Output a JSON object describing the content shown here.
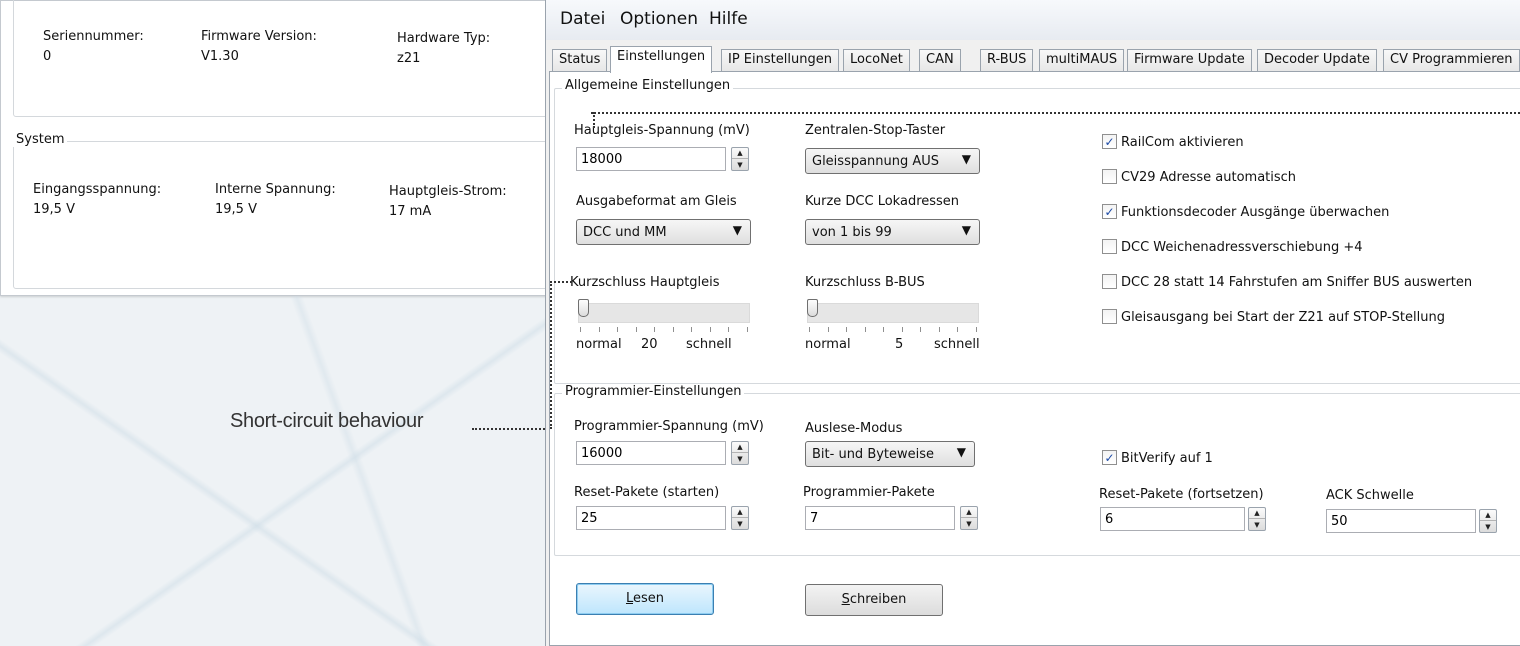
{
  "status_window": {
    "device": {
      "serial_label": "Seriennummer:",
      "serial_value": "0",
      "firmware_label": "Firmware Version:",
      "firmware_value": "V1.30",
      "hardware_label": "Hardware Typ:",
      "hardware_value": "z21"
    },
    "system": {
      "title": "System",
      "input_voltage_label": "Eingangsspannung:",
      "input_voltage_value": "19,5 V",
      "internal_voltage_label": "Interne Spannung:",
      "internal_voltage_value": "19,5 V",
      "track_current_label": "Hauptgleis-Strom:",
      "track_current_value": "17 mA"
    }
  },
  "annotation": {
    "caption": "Short-circuit behaviour"
  },
  "settings_window": {
    "menu": [
      "Datei",
      "Optionen",
      "Hilfe"
    ],
    "tabs": [
      "Status",
      "Einstellungen",
      "IP Einstellungen",
      "LocoNet",
      "CAN",
      "R-BUS",
      "multiMAUS",
      "Firmware Update",
      "Decoder Update",
      "CV Programmieren"
    ],
    "active_tab": "Einstellungen",
    "general": {
      "title": "Allgemeine Einstellungen",
      "main_voltage_label": "Hauptgleis-Spannung (mV)",
      "main_voltage_value": "18000",
      "stop_button_label": "Zentralen-Stop-Taster",
      "stop_button_value": "Gleisspannung AUS",
      "output_format_label": "Ausgabeformat am Gleis",
      "output_format_value": "DCC und MM",
      "short_dcc_label": "Kurze DCC Lokadressen",
      "short_dcc_value": "von 1 bis 99",
      "short_main_label": "Kurzschluss Hauptgleis",
      "short_main_min": "normal",
      "short_main_value": "20",
      "short_main_max": "schnell",
      "short_bbus_label": "Kurzschluss B-BUS",
      "short_bbus_min": "normal",
      "short_bbus_value": "5",
      "short_bbus_max": "schnell",
      "short_main_level": 0.0,
      "short_bbus_level": 0.0,
      "checkboxes": [
        {
          "label": "RailCom aktivieren",
          "checked": true
        },
        {
          "label": "CV29 Adresse automatisch",
          "checked": false
        },
        {
          "label": "Funktionsdecoder Ausgänge überwachen",
          "checked": true
        },
        {
          "label": "DCC Weichenadressverschiebung +4",
          "checked": false
        },
        {
          "label": "DCC 28 statt 14 Fahrstufen am Sniffer BUS auswerten",
          "checked": false
        },
        {
          "label": "Gleisausgang bei Start der Z21 auf STOP-Stellung",
          "checked": false
        }
      ]
    },
    "programmer": {
      "title": "Programmier-Einstellungen",
      "prog_voltage_label": "Programmier-Spannung (mV)",
      "prog_voltage_value": "16000",
      "read_mode_label": "Auslese-Modus",
      "read_mode_value": "Bit- und Byteweise",
      "bitverify_label": "BitVerify auf 1",
      "bitverify_checked": true,
      "reset_start_label": "Reset-Pakete (starten)",
      "reset_start_value": "25",
      "prog_packets_label": "Programmier-Pakete",
      "prog_packets_value": "7",
      "reset_continue_label": "Reset-Pakete (fortsetzen)",
      "reset_continue_value": "6",
      "ack_label": "ACK Schwelle",
      "ack_value": "50"
    },
    "buttons": {
      "read": "Lesen",
      "write": "Schreiben"
    }
  }
}
